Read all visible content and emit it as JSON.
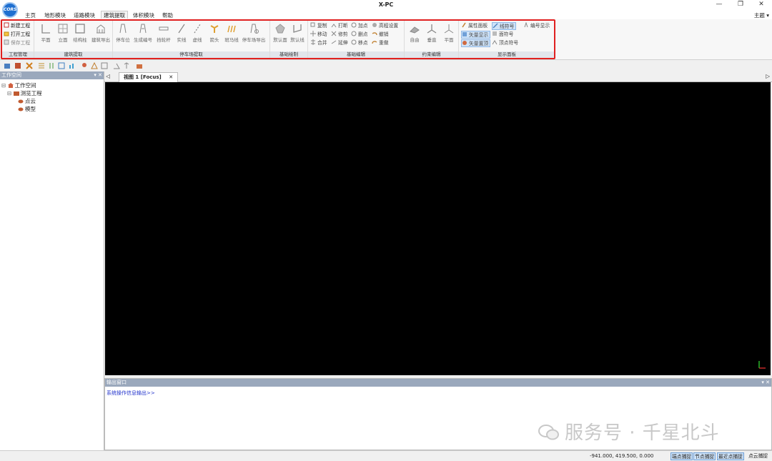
{
  "app": {
    "title": "X-PC",
    "logo_text": "CORS",
    "theme_label": "主题 ▾"
  },
  "window_controls": {
    "minimize": "—",
    "restore": "❐",
    "close": "✕"
  },
  "menu": [
    "主页",
    "地形模块",
    "道路模块",
    "建筑提取",
    "体积模块",
    "帮助"
  ],
  "menu_active": "建筑提取",
  "ribbon": {
    "groups": {
      "project": {
        "label": "工程管理",
        "buttons": [
          "新建工程",
          "打开工程",
          "保存工程"
        ]
      },
      "building": {
        "label": "建筑提取",
        "buttons": [
          "平面",
          "立面",
          "结构柱",
          "建筑导出"
        ]
      },
      "parking": {
        "label": "停车场提取",
        "buttons": [
          "停车位",
          "生成编号",
          "挡轮杆",
          "实线",
          "虚线",
          "箭头",
          "斑马线",
          "停车场导出"
        ]
      },
      "basic_draw": {
        "label": "基础绘制",
        "buttons": [
          "默认面",
          "默认线"
        ]
      },
      "basic_edit": {
        "label": "基础编辑",
        "buttons": [
          "复制",
          "打断",
          "加点",
          "高程设置",
          "移动",
          "修剪",
          "删点",
          "撤销",
          "合并",
          "延伸",
          "移点",
          "重做"
        ]
      },
      "constraint": {
        "label": "约束编辑",
        "buttons": [
          "自由",
          "垂直",
          "平面"
        ]
      },
      "display": {
        "label": "显示面板",
        "buttons": [
          "属性面板",
          "线符号",
          "编号显示",
          "矢量显示",
          "面符号",
          "矢量置顶",
          "顶点符号"
        ]
      }
    }
  },
  "workspace": {
    "title": "工作空间",
    "controls": "▾ ✕",
    "tree": {
      "root": "工作空间",
      "project": "测览工程",
      "children": [
        "点云",
        "模型"
      ]
    }
  },
  "view_tab": {
    "label": "视图 1 [Focus]",
    "close": "✕",
    "left_arrow": "◁",
    "right_arrow": "▷"
  },
  "output": {
    "title": "输出窗口",
    "controls": "▾ ✕",
    "text": "系统操作信息输出>>"
  },
  "watermark": {
    "text": "服务号 · 千星北斗"
  },
  "status": {
    "coords": "-941.000, 419.500, 0.000",
    "snaps": [
      "端点捕捉",
      "节点捕捉",
      "最近点捕捉",
      "点云捕捉"
    ]
  },
  "colors": {
    "accent": "#1f6fd0",
    "highlight_frame": "#e02020",
    "viewport": "#000000"
  }
}
